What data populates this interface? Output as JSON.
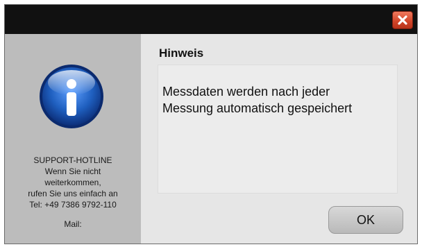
{
  "dialog": {
    "heading": "Hinweis",
    "message_lines": [
      "Messdaten werden nach jeder",
      "Messung automatisch gespeichert"
    ],
    "ok_label": "OK",
    "close_icon": "close-icon",
    "info_icon": "info-icon"
  },
  "support": {
    "title": "SUPPORT-HOTLINE",
    "line1": "Wenn Sie nicht",
    "line2": "weiterkommen,",
    "line3": "rufen Sie uns einfach an",
    "tel": "Tel: +49 7386 9792-110",
    "mail": "Mail:"
  },
  "colors": {
    "titlebar": "#111111",
    "close_button": "#d2472b",
    "info_blue": "#1f5fbf"
  }
}
